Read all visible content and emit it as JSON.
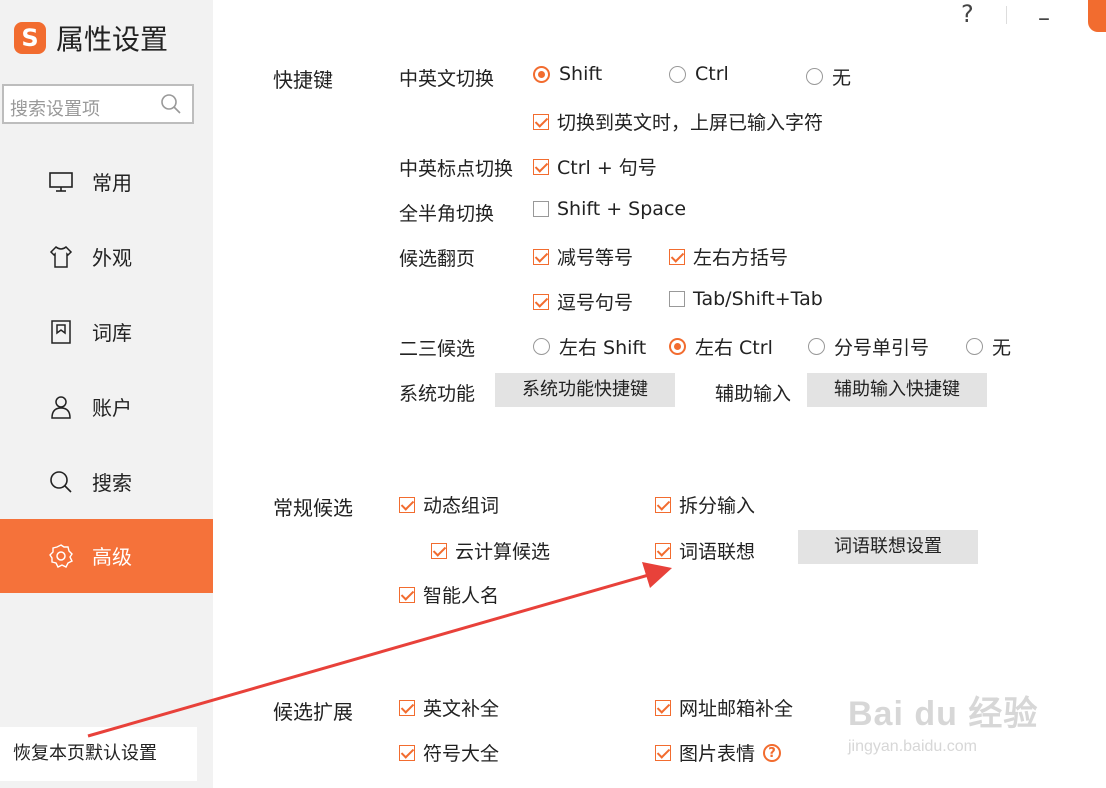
{
  "app": {
    "title": "属性设置",
    "logo_letter": "S"
  },
  "titlebar": {
    "help": "?",
    "minimize": "–"
  },
  "search": {
    "placeholder": "搜索设置项"
  },
  "nav": [
    {
      "label": "常用",
      "icon": "monitor-icon"
    },
    {
      "label": "外观",
      "icon": "shirt-icon"
    },
    {
      "label": "词库",
      "icon": "dictionary-icon"
    },
    {
      "label": "账户",
      "icon": "user-icon"
    },
    {
      "label": "搜索",
      "icon": "search-icon"
    },
    {
      "label": "高级",
      "icon": "gear-icon",
      "active": true
    }
  ],
  "reset_label": "恢复本页默认设置",
  "shortcuts": {
    "section": "快捷键",
    "cn_en_switch": {
      "label": "中英文切换",
      "options": [
        "Shift",
        "Ctrl",
        "无"
      ],
      "selected": "Shift"
    },
    "commit_on_switch": "切换到英文时，上屏已输入字符",
    "punct_switch": {
      "label": "中英标点切换",
      "option": "Ctrl + 句号"
    },
    "halfwidth_switch": {
      "label": "全半角切换",
      "option": "Shift + Space"
    },
    "page_turn": {
      "label": "候选翻页",
      "options": [
        "减号等号",
        "左右方括号",
        "逗号句号",
        "Tab/Shift+Tab"
      ]
    },
    "second_third": {
      "label": "二三候选",
      "options": [
        "左右 Shift",
        "左右 Ctrl",
        "分号单引号",
        "无"
      ],
      "selected": "左右 Ctrl"
    },
    "system_func": {
      "label": "系统功能",
      "button": "系统功能快捷键"
    },
    "aux_input": {
      "label": "辅助输入",
      "button": "辅助输入快捷键"
    }
  },
  "general": {
    "section": "常规候选",
    "dynamic_words": "动态组词",
    "split_input": "拆分输入",
    "cloud_candidates": "云计算候选",
    "word_association": "词语联想",
    "association_settings": "词语联想设置",
    "smart_names": "智能人名"
  },
  "extension": {
    "section": "候选扩展",
    "english_complete": "英文补全",
    "url_email_complete": "网址邮箱补全",
    "symbols": "符号大全",
    "image_emoji": "图片表情"
  },
  "watermark": {
    "brand": "Bai du 经验",
    "url": "jingyan.baidu.com"
  },
  "colors": {
    "accent": "#f26c2f",
    "active_nav": "#f5723a",
    "sidebar_bg": "#f2f2f2",
    "button_bg": "#e3e3e3",
    "annotation_arrow": "#e8413a"
  }
}
